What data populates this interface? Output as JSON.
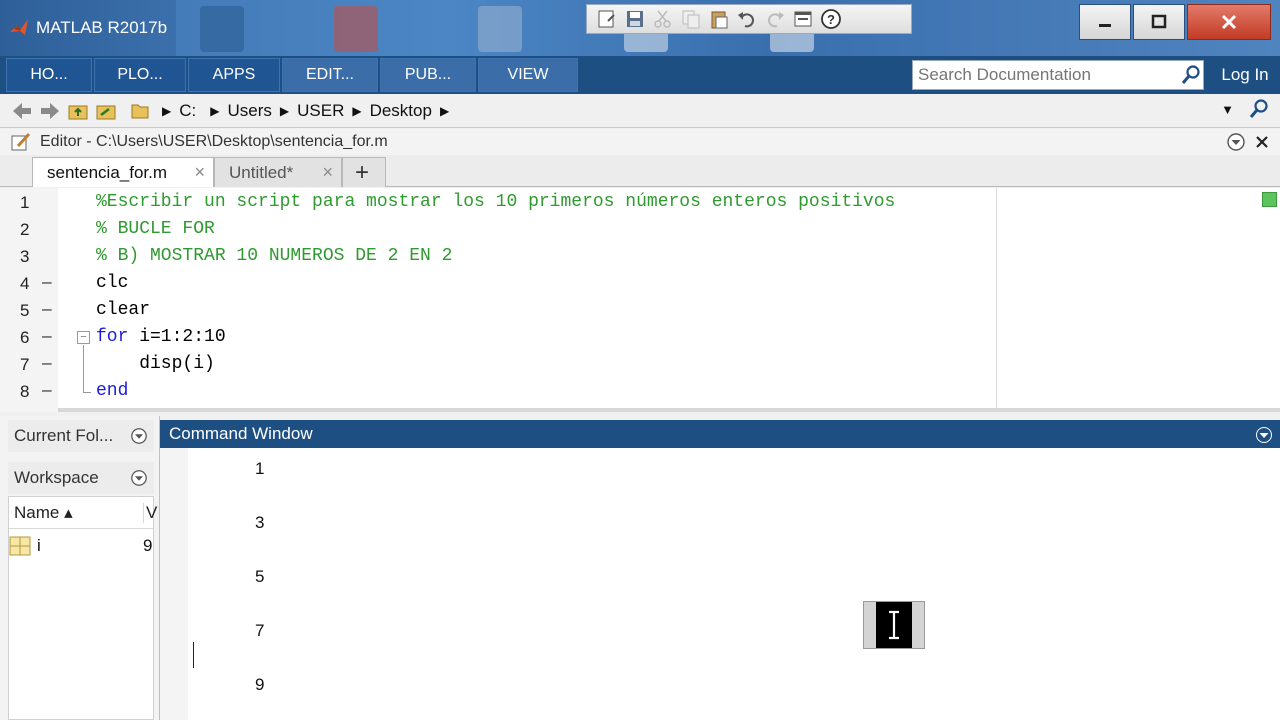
{
  "window": {
    "title": "MATLAB R2017b"
  },
  "toolstrip": {
    "tabs": [
      "HO...",
      "PLO...",
      "APPS",
      "EDIT...",
      "PUB...",
      "VIEW"
    ],
    "search_placeholder": "Search Documentation",
    "login_label": "Log In"
  },
  "address": {
    "crumbs": [
      "C:",
      "Users",
      "USER",
      "Desktop"
    ]
  },
  "editor": {
    "title": "Editor - C:\\Users\\USER\\Desktop\\sentencia_for.m",
    "tabs": [
      {
        "label": "sentencia_for.m"
      },
      {
        "label": "Untitled*"
      }
    ],
    "add_tab_label": "+",
    "lines": [
      {
        "num": "1",
        "dash": "",
        "text": "%Escribir un script para mostrar los 10 primeros números enteros positivos"
      },
      {
        "num": "2",
        "dash": "",
        "text": "% BUCLE FOR"
      },
      {
        "num": "3",
        "dash": "",
        "text": "% B) MOSTRAR 10 NUMEROS DE 2 EN 2"
      },
      {
        "num": "4",
        "dash": "—",
        "text": "clc"
      },
      {
        "num": "5",
        "dash": "—",
        "text": "clear"
      },
      {
        "num": "6",
        "dash": "—",
        "keyword": "for",
        "rest": " i=1:2:10"
      },
      {
        "num": "7",
        "dash": "—",
        "text": "    disp(i)"
      },
      {
        "num": "8",
        "dash": "—",
        "keyword": "end",
        "rest": ""
      }
    ]
  },
  "panels": {
    "current_folder": "Current Fol...",
    "workspace": "Workspace",
    "ws_columns": {
      "name": "Name ▴",
      "value": "V"
    },
    "ws_rows": [
      {
        "name": "i",
        "value": "9"
      }
    ]
  },
  "command_window": {
    "title": "Command Window",
    "output": [
      "1",
      "3",
      "5",
      "7",
      "9"
    ]
  },
  "colors": {
    "toolstrip": "#1d4f83",
    "comment": "#2f9a2f",
    "keyword": "#1b1bdb"
  }
}
